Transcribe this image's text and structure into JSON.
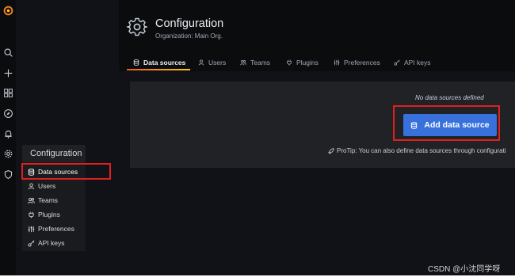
{
  "header": {
    "title": "Configuration",
    "subtitle": "Organization: Main Org."
  },
  "tabs": [
    {
      "label": "Data sources",
      "icon": "database-icon",
      "active": true
    },
    {
      "label": "Users",
      "icon": "user-icon"
    },
    {
      "label": "Teams",
      "icon": "users-icon"
    },
    {
      "label": "Plugins",
      "icon": "plug-icon"
    },
    {
      "label": "Preferences",
      "icon": "sliders-icon"
    },
    {
      "label": "API keys",
      "icon": "key-icon"
    }
  ],
  "side_menu": {
    "icons": [
      "grafana-logo",
      "search-icon",
      "plus-icon",
      "dashboards-icon",
      "explore-icon",
      "bell-icon",
      "gear-icon",
      "shield-icon"
    ],
    "flyout_title": "Configuration",
    "flyout_items": [
      {
        "label": "Data sources",
        "icon": "database-icon",
        "active": true
      },
      {
        "label": "Users",
        "icon": "user-icon"
      },
      {
        "label": "Teams",
        "icon": "users-icon"
      },
      {
        "label": "Plugins",
        "icon": "plug-icon"
      },
      {
        "label": "Preferences",
        "icon": "sliders-icon"
      },
      {
        "label": "API keys",
        "icon": "key-icon"
      }
    ]
  },
  "empty_state": {
    "message": "No data sources defined",
    "button_label": "Add data source",
    "protip": "ProTip: You can also define data sources through configurati"
  },
  "watermark": "CSDN @小沈同学呀",
  "colors": {
    "accent_blue": "#3871dc",
    "highlight_red": "#e02020",
    "tab_underline_start": "#f05a28",
    "tab_underline_end": "#fbca0a"
  }
}
